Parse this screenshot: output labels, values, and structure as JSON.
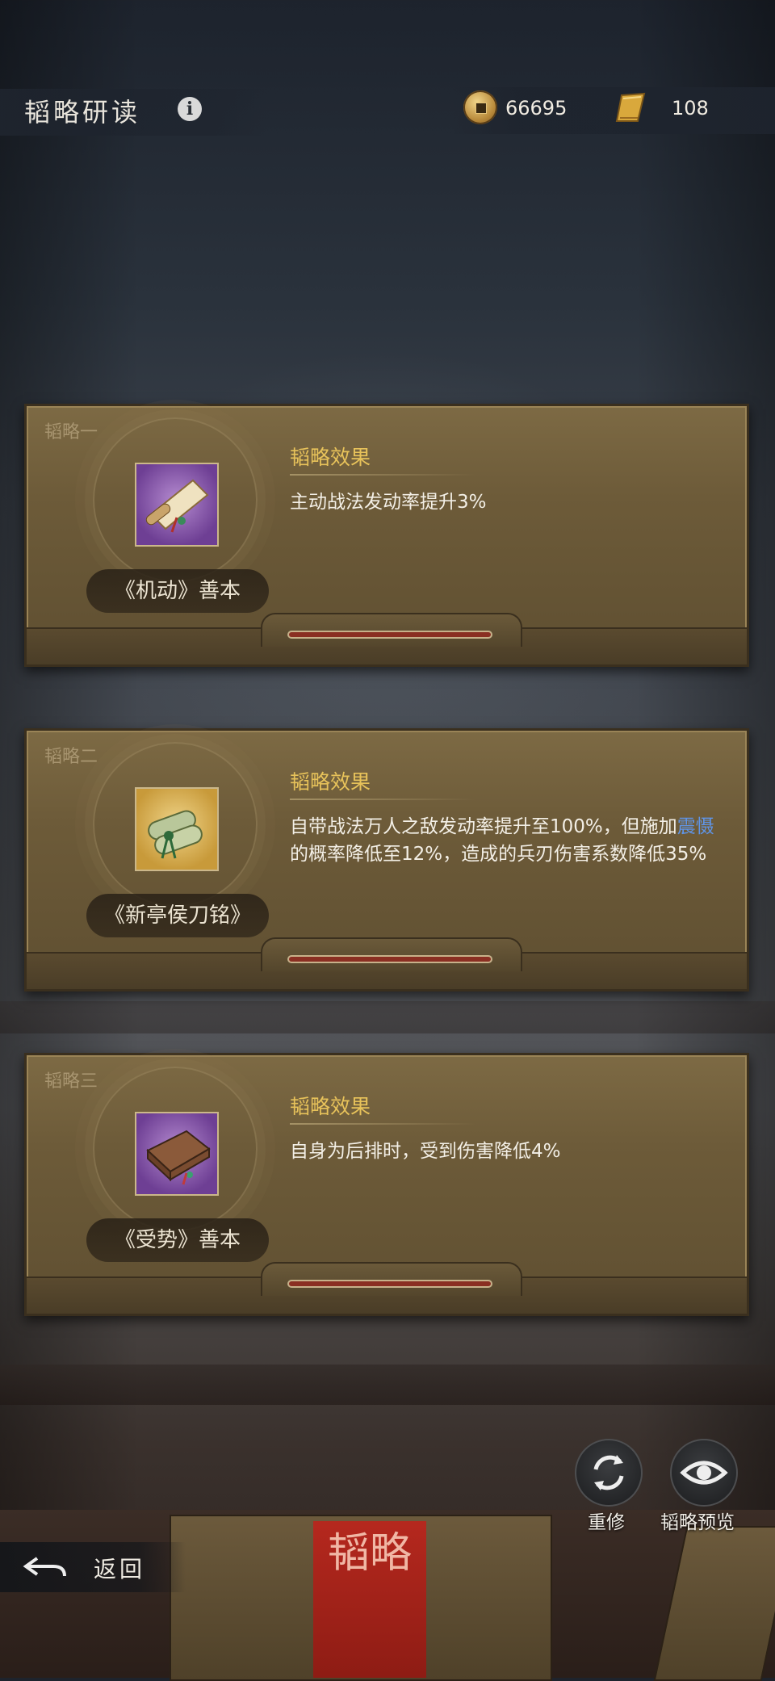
{
  "header": {
    "title": "韬略研读",
    "info_icon": "info-icon"
  },
  "resources": {
    "coins": "66695",
    "scrolls": "108"
  },
  "cards": [
    {
      "tag": "韬略一",
      "item_name": "《机动》善本",
      "item_quality": "purple",
      "effect_title": "韬略效果",
      "effect_text": "主动战法发动率提升3%"
    },
    {
      "tag": "韬略二",
      "item_name": "《新亭侯刀铭》",
      "item_quality": "gold",
      "effect_title": "韬略效果",
      "effect_text_a": "自带战法万人之敌发动率提升至100%，但施加",
      "effect_text_highlight": "震慑",
      "effect_text_b": "的概率降低至12%，造成的兵刃伤害系数降低35%"
    },
    {
      "tag": "韬略三",
      "item_name": "《受势》善本",
      "item_quality": "purple",
      "effect_title": "韬略效果",
      "effect_text": "自身为后排时，受到伤害降低4%"
    }
  ],
  "buttons": {
    "reset_label": "重修",
    "preview_label": "韬略预览",
    "back_label": "返回"
  },
  "desk_book_text": "韬略",
  "colors": {
    "accent_gold": "#e7c25a",
    "highlight_blue": "#5f95e8",
    "card_bg": "#6d5b39"
  }
}
